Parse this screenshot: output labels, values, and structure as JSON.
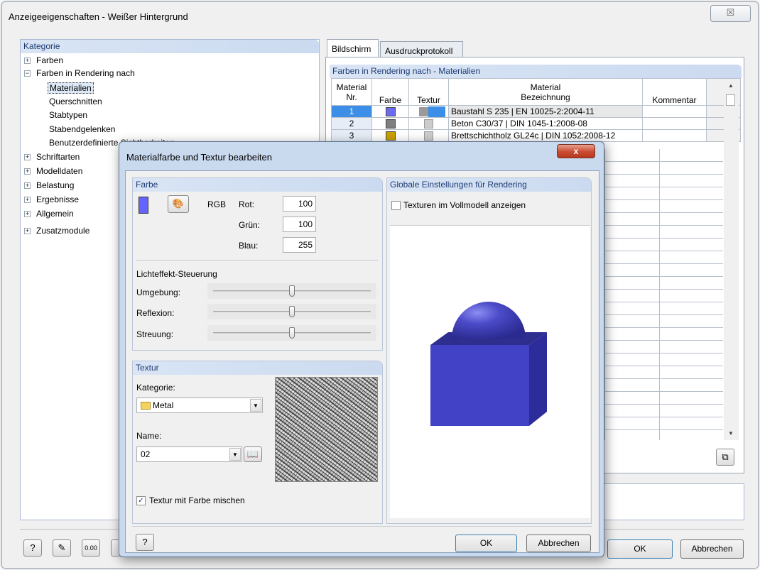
{
  "window": {
    "title": "Anzeigeeigenschaften - Weißer Hintergrund",
    "close_label": "☒"
  },
  "category": {
    "header": "Kategorie",
    "items": [
      {
        "label": "Farben",
        "toggle": "+"
      },
      {
        "label": "Farben in Rendering nach",
        "toggle": "−"
      },
      {
        "label": "Materialien"
      },
      {
        "label": "Querschnitten"
      },
      {
        "label": "Stabtypen"
      },
      {
        "label": "Stabendgelenken"
      },
      {
        "label": "Benutzerdefinierte Sichtbarkeiten"
      },
      {
        "label": "Schriftarten",
        "toggle": "+"
      },
      {
        "label": "Modelldaten",
        "toggle": "+"
      },
      {
        "label": "Belastung",
        "toggle": "+"
      },
      {
        "label": "Ergebnisse",
        "toggle": "+"
      },
      {
        "label": "Allgemein",
        "toggle": "+"
      },
      {
        "label": "Zusatzmodule",
        "toggle": "+"
      }
    ]
  },
  "tabs": [
    "Bildschirm",
    "Ausdruckprotokoll"
  ],
  "table": {
    "header": "Farben in Rendering nach - Materialien",
    "col_nr": "Material Nr.",
    "col_farbe": "Farbe",
    "col_textur": "Textur",
    "col_material": "Material",
    "col_bez": "Bezeichnung",
    "col_komm": "Kommentar",
    "rows": [
      {
        "nr": "1",
        "color": "#6b6bf2",
        "name": "Baustahl S 235 | EN 10025-2:2004-11"
      },
      {
        "nr": "2",
        "color": "#7f7f7f",
        "name": "Beton C30/37 | DIN 1045-1:2008-08"
      },
      {
        "nr": "3",
        "color": "#c8a000",
        "name": "Brettschichtholz GL24c | DIN 1052:2008-12"
      }
    ]
  },
  "main_buttons": {
    "ok": "OK",
    "cancel": "Abbrechen"
  },
  "dialog": {
    "title": "Materialfarbe und Textur bearbeiten",
    "close_label": "x",
    "farbe": {
      "header": "Farbe",
      "rgb": "RGB",
      "rot_label": "Rot:",
      "rot": "100",
      "gruen_label": "Grün:",
      "gruen": "100",
      "blau_label": "Blau:",
      "blau": "255",
      "swatch": "#6464ff"
    },
    "licht": {
      "header": "Lichteffekt-Steuerung",
      "umgebung": "Umgebung:",
      "reflexion": "Reflexion:",
      "streuung": "Streuung:",
      "umgebung_value": 0.5,
      "reflexion_value": 0.5,
      "streuung_value": 0.5
    },
    "textur": {
      "header": "Textur",
      "kategorie_label": "Kategorie:",
      "kategorie": "Metal",
      "name_label": "Name:",
      "name": "02",
      "mix_label": "Textur mit Farbe mischen",
      "mix_checked": true
    },
    "global": {
      "header": "Globale Einstellungen für Rendering",
      "vollmodell_label": "Texturen im Vollmodell anzeigen",
      "vollmodell_checked": false
    },
    "ok": "OK",
    "cancel": "Abbrechen"
  }
}
